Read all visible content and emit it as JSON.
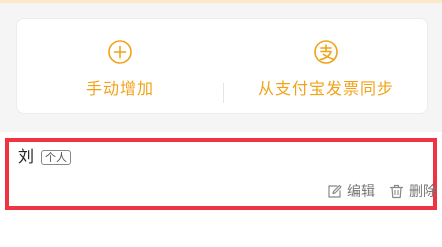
{
  "actions": {
    "manual_label": "手动增加",
    "manual_icon": "plus-circle-icon",
    "alipay_label": "从支付宝发票同步",
    "alipay_icon": "alipay-icon"
  },
  "entry": {
    "name": "刘",
    "type_badge": "个人",
    "edit_label": "编辑",
    "edit_icon": "edit-icon",
    "delete_label": "删除",
    "delete_icon": "trash-icon"
  },
  "colors": {
    "accent": "#f0a319",
    "highlight": "#ef3340",
    "background": "#f5f5f5"
  }
}
